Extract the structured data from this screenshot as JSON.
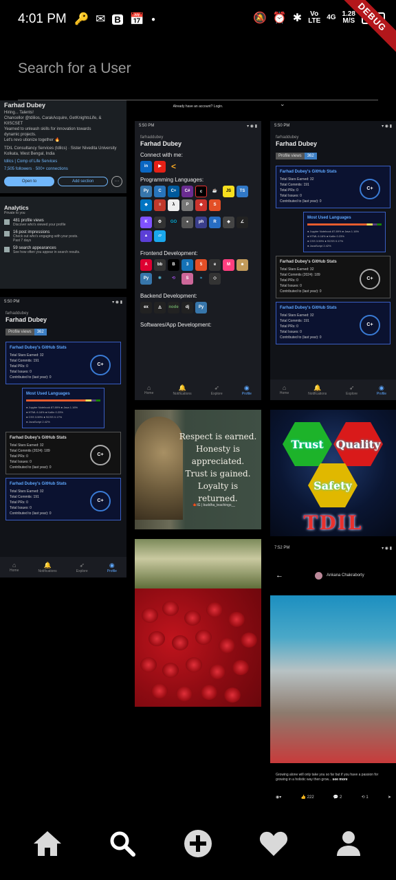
{
  "status_bar": {
    "time": "4:01 PM",
    "icons_left": [
      "key-icon",
      "gmail-icon",
      "b-icon",
      "calendar-icon",
      "dot-icon"
    ],
    "volte": "Vo LTE",
    "network": "4G",
    "speed_value": "1.28",
    "speed_unit": "M/S",
    "battery": "85",
    "debug_banner": "DEBUG"
  },
  "search": {
    "placeholder": "Search for a User"
  },
  "linkedin_tile": {
    "name": "Farhad Dubey",
    "headline_1": "Hiring... Talents!",
    "headline_2": "Chancellor @tdilios, CarakAcquire, GetKnightsLife, &",
    "headline_3": "KIISCSET",
    "headline_4": "Yearned to unleash skills for innovation towards",
    "headline_5": "dynamic projects.",
    "headline_6": "Let's revo utionize together 🔥",
    "org": "TDIL Consultancy Services (tdilcs) · Sister Nivedita University",
    "location": "Kolkata, West Bengal, India",
    "link": "tdilcs | Comp of Life Services",
    "followers": "7,505 followers · 500+ connections",
    "btn_open": "Open to",
    "btn_add": "Add section",
    "btn_more": "···",
    "analytics_title": "Analytics",
    "analytics_sub": "Private to you",
    "a1_title": "481 profile views",
    "a1_sub": "Discover who's viewed your profile",
    "a2_title": "16 post impressions",
    "a2_sub": "Check out who's engaging with your posts.",
    "a2_sub2": "Past 7 days",
    "a3_title": "59 search appearances",
    "a3_sub": "See how often you appear in search results."
  },
  "top_strip": {
    "login_text": "Already have an account? Login.",
    "chevron": "⌄"
  },
  "gh_profile": {
    "time": "5:50 PM",
    "username": "farhaddubey",
    "fullname": "Farhad Dubey",
    "views_label": "Profile views",
    "views_value": "362",
    "stats_title": "Farhad Dubey's GitHub Stats",
    "stats_lines": [
      "Total Stars Earned:    32",
      "Total Commits:        191",
      "Total PRs:             0",
      "Total Issues:          0",
      "Contributed to (last year):   0"
    ],
    "stats_lines_2024": [
      "Total Stars Earned:    32",
      "Total Commits (2024):  189",
      "Total PRs:             0",
      "Total Issues:          0",
      "Contributed to (last year):   0"
    ],
    "grade": "C+",
    "lang_title": "Most Used Languages",
    "lang_lines": [
      "● Jupyter Notebook 87.89%   ● Java 1.16%",
      "● HTML 6.16%                ● Kotlin 0.23%",
      "● CSS 3.59%                 ● SCSS 0.17%",
      "● JavaScript 2.42%"
    ],
    "nav": [
      "Home",
      "Notifications",
      "Explore",
      "Profile"
    ]
  },
  "skills_tile": {
    "time": "5:50 PM",
    "username": "farhaddubey",
    "fullname": "Farhad Dubey",
    "connect": "Connect with me:",
    "programming": "Programming Languages:",
    "frontend": "Frontend Development:",
    "backend": "Backend Development:",
    "software": "Softwares/App Development:",
    "nav": [
      "Home",
      "Notifications",
      "Explore",
      "Profile"
    ]
  },
  "quote_tile": {
    "line_1": "Respect is earned.",
    "line_2": "Honesty is",
    "line_3": "appreciated.",
    "line_4": "Trust is gained.",
    "line_5": "Loyalty is returned.",
    "tag": "🍁IG | buddha_teachings__"
  },
  "tdil_tile": {
    "hex_1": "Trust",
    "hex_2": "Quality",
    "hex_3": "Safety",
    "brand": "TDIL",
    "colors": {
      "green": "#1db32a",
      "red": "#d91a1a",
      "yellow": "#e0b800"
    }
  },
  "post_tile": {
    "time": "7:52 PM",
    "author": "Ankana Chakraborty",
    "caption": "Growing alone will only take you so far but if you have a passion for growing in a holistic way then grow...",
    "see_more": "see more",
    "reactions": "222",
    "comments": "2",
    "reposts": "1"
  },
  "bottom_nav": [
    "home-icon",
    "search-icon",
    "add-icon",
    "favorite-icon",
    "profile-icon"
  ]
}
